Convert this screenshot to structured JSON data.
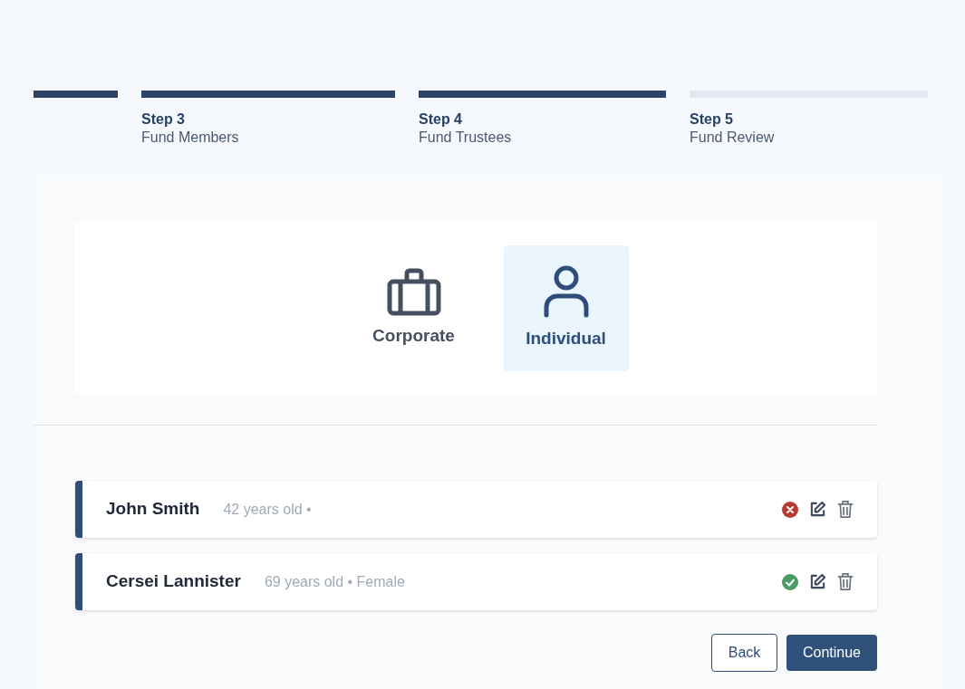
{
  "steps": [
    {
      "complete": true
    },
    {
      "title": "Step 3",
      "subtitle": "Fund Members",
      "complete": true
    },
    {
      "title": "Step 4",
      "subtitle": "Fund Trustees",
      "complete": true
    },
    {
      "title": "Step 5",
      "subtitle": "Fund Review",
      "complete": false
    }
  ],
  "trustee_types": [
    {
      "kind": "corporate",
      "label": "Corporate",
      "selected": false
    },
    {
      "kind": "individual",
      "label": "Individual",
      "selected": true
    }
  ],
  "trustees": [
    {
      "name": "John Smith",
      "details": "42 years old •",
      "valid": false
    },
    {
      "name": "Cersei Lannister",
      "details": "69 years old • Female",
      "valid": true
    }
  ],
  "buttons": {
    "back": "Back",
    "continue": "Continue"
  }
}
